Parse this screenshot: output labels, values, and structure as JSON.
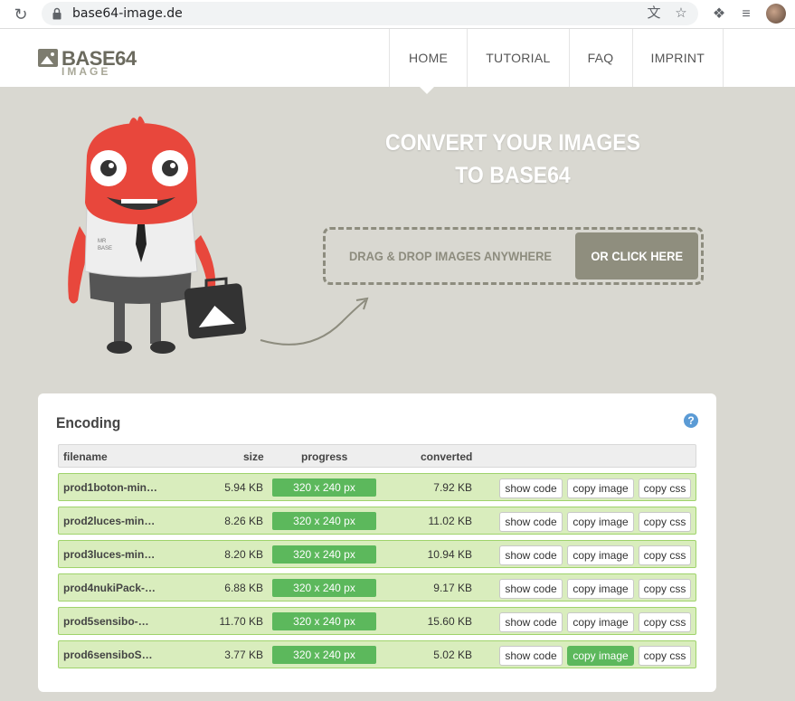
{
  "browser": {
    "url": "base64-image.de"
  },
  "logo": {
    "line1": "BASE64",
    "line2": "IMAGE"
  },
  "nav": {
    "home": "HOME",
    "tutorial": "TUTORIAL",
    "faq": "FAQ",
    "imprint": "IMPRINT"
  },
  "hero": {
    "title_line1": "CONVERT YOUR IMAGES",
    "title_line2": "TO BASE64",
    "drop_label": "DRAG & DROP IMAGES ANYWHERE",
    "click_label": "OR CLICK HERE",
    "mascot_shirt": "MR BASE"
  },
  "encoding": {
    "title": "Encoding",
    "help": "?",
    "columns": {
      "filename": "filename",
      "size": "size",
      "progress": "progress",
      "converted": "converted"
    },
    "rows": [
      {
        "filename": "prod1boton-min…",
        "size": "5.94 KB",
        "progress": "320 x 240 px",
        "converted": "7.92 KB",
        "show": "show code",
        "copy_image": "copy image",
        "copy_css": "copy css"
      },
      {
        "filename": "prod2luces-min…",
        "size": "8.26 KB",
        "progress": "320 x 240 px",
        "converted": "11.02 KB",
        "show": "show code",
        "copy_image": "copy image",
        "copy_css": "copy css"
      },
      {
        "filename": "prod3luces-min…",
        "size": "8.20 KB",
        "progress": "320 x 240 px",
        "converted": "10.94 KB",
        "show": "show code",
        "copy_image": "copy image",
        "copy_css": "copy css"
      },
      {
        "filename": "prod4nukiPack-…",
        "size": "6.88 KB",
        "progress": "320 x 240 px",
        "converted": "9.17 KB",
        "show": "show code",
        "copy_image": "copy image",
        "copy_css": "copy css"
      },
      {
        "filename": "prod5sensibo-…",
        "size": "11.70 KB",
        "progress": "320 x 240 px",
        "converted": "15.60 KB",
        "show": "show code",
        "copy_image": "copy image",
        "copy_css": "copy css"
      },
      {
        "filename": "prod6sensiboS…",
        "size": "3.77 KB",
        "progress": "320 x 240 px",
        "converted": "5.02 KB",
        "show": "show code",
        "copy_image": "copy image",
        "copy_css": "copy css"
      }
    ]
  },
  "colors": {
    "page_bg": "#d9d8d1",
    "accent_green": "#5cb85c",
    "row_bg": "#d9edbd",
    "mascot_red": "#e8473c"
  }
}
